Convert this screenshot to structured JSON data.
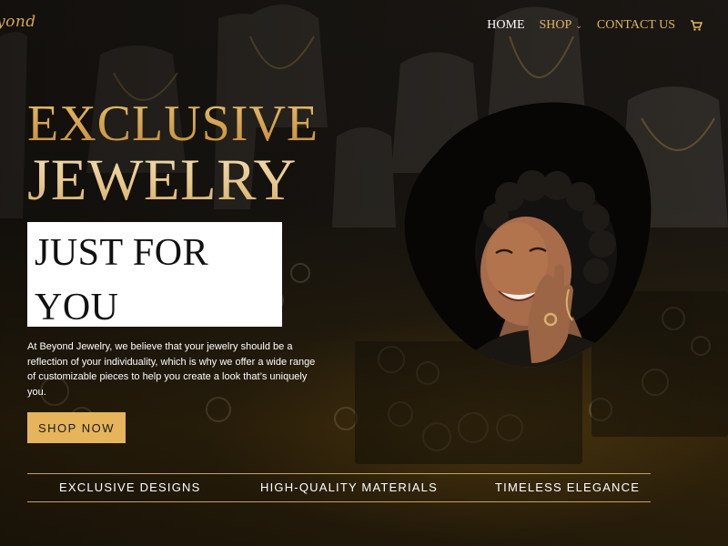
{
  "brand": {
    "logo_text": "yond"
  },
  "nav": {
    "items": [
      {
        "label": "HOME"
      },
      {
        "label": "SHOP"
      },
      {
        "label": "CONTACT US"
      }
    ],
    "cart_icon": "shopping-cart-icon"
  },
  "hero": {
    "title_line1": "EXCLUSIVE",
    "title_line2": "JEWELRY",
    "boxed_line1": "JUST FOR",
    "boxed_line2": "YOU",
    "description": "At Beyond Jewelry, we believe that your jewelry should be a reflection of your individuality, which is why we offer a wide range of customizable pieces to help you create a look that’s uniquely you.",
    "cta_label": "SHOP NOW"
  },
  "features": [
    {
      "label": "EXCLUSIVE DESIGNS"
    },
    {
      "label": "HIGH-QUALITY MATERIALS"
    },
    {
      "label": "TIMELESS ELEGANCE"
    }
  ],
  "colors": {
    "accent_gold": "#e6b45a",
    "nav_active": "#ffffff",
    "nav_link": "#e1b35e",
    "divider": "#c8a15a"
  }
}
